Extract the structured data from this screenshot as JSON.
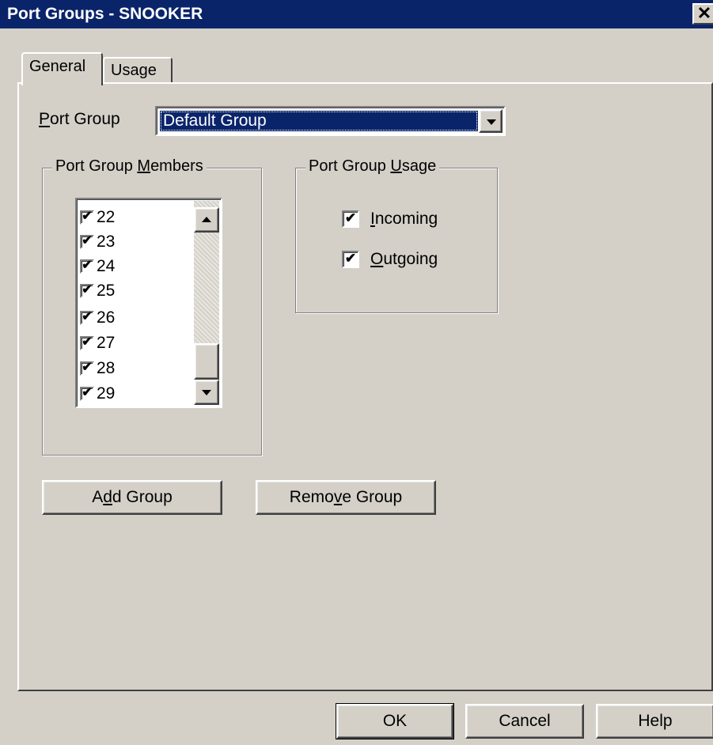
{
  "window": {
    "title": "Port Groups - SNOOKER",
    "close_glyph": "✕"
  },
  "tabs": [
    {
      "label": "General",
      "active": true
    },
    {
      "label": "Usage",
      "active": false
    }
  ],
  "port_group": {
    "label_prefix": "P",
    "label_rest": "ort Group",
    "selected": "Default Group"
  },
  "members": {
    "title_prefix": "Port Group ",
    "title_u": "M",
    "title_rest": "embers",
    "items": [
      {
        "label": "22",
        "checked": true
      },
      {
        "label": "23",
        "checked": true
      },
      {
        "label": "24",
        "checked": true
      },
      {
        "label": "25",
        "checked": true
      },
      {
        "label": "26",
        "checked": true
      },
      {
        "label": "27",
        "checked": true
      },
      {
        "label": "28",
        "checked": true
      },
      {
        "label": "29",
        "checked": true
      }
    ]
  },
  "usage": {
    "title_prefix": "Port Group ",
    "title_u": "U",
    "title_rest": "sage",
    "incoming": {
      "u": "I",
      "rest": "ncoming",
      "checked": true
    },
    "outgoing": {
      "u": "O",
      "rest": "utgoing",
      "checked": true
    }
  },
  "buttons": {
    "add_group": {
      "pre": "A",
      "u": "d",
      "post": "d Group"
    },
    "remove_group": {
      "pre": "Remo",
      "u": "v",
      "post": "e Group"
    },
    "ok": "OK",
    "cancel": "Cancel",
    "help": "Help"
  },
  "check_glyph": "✔",
  "colors": {
    "title_bar": "#0a246a",
    "face": "#d4d0c8",
    "selection": "#0a246a"
  }
}
